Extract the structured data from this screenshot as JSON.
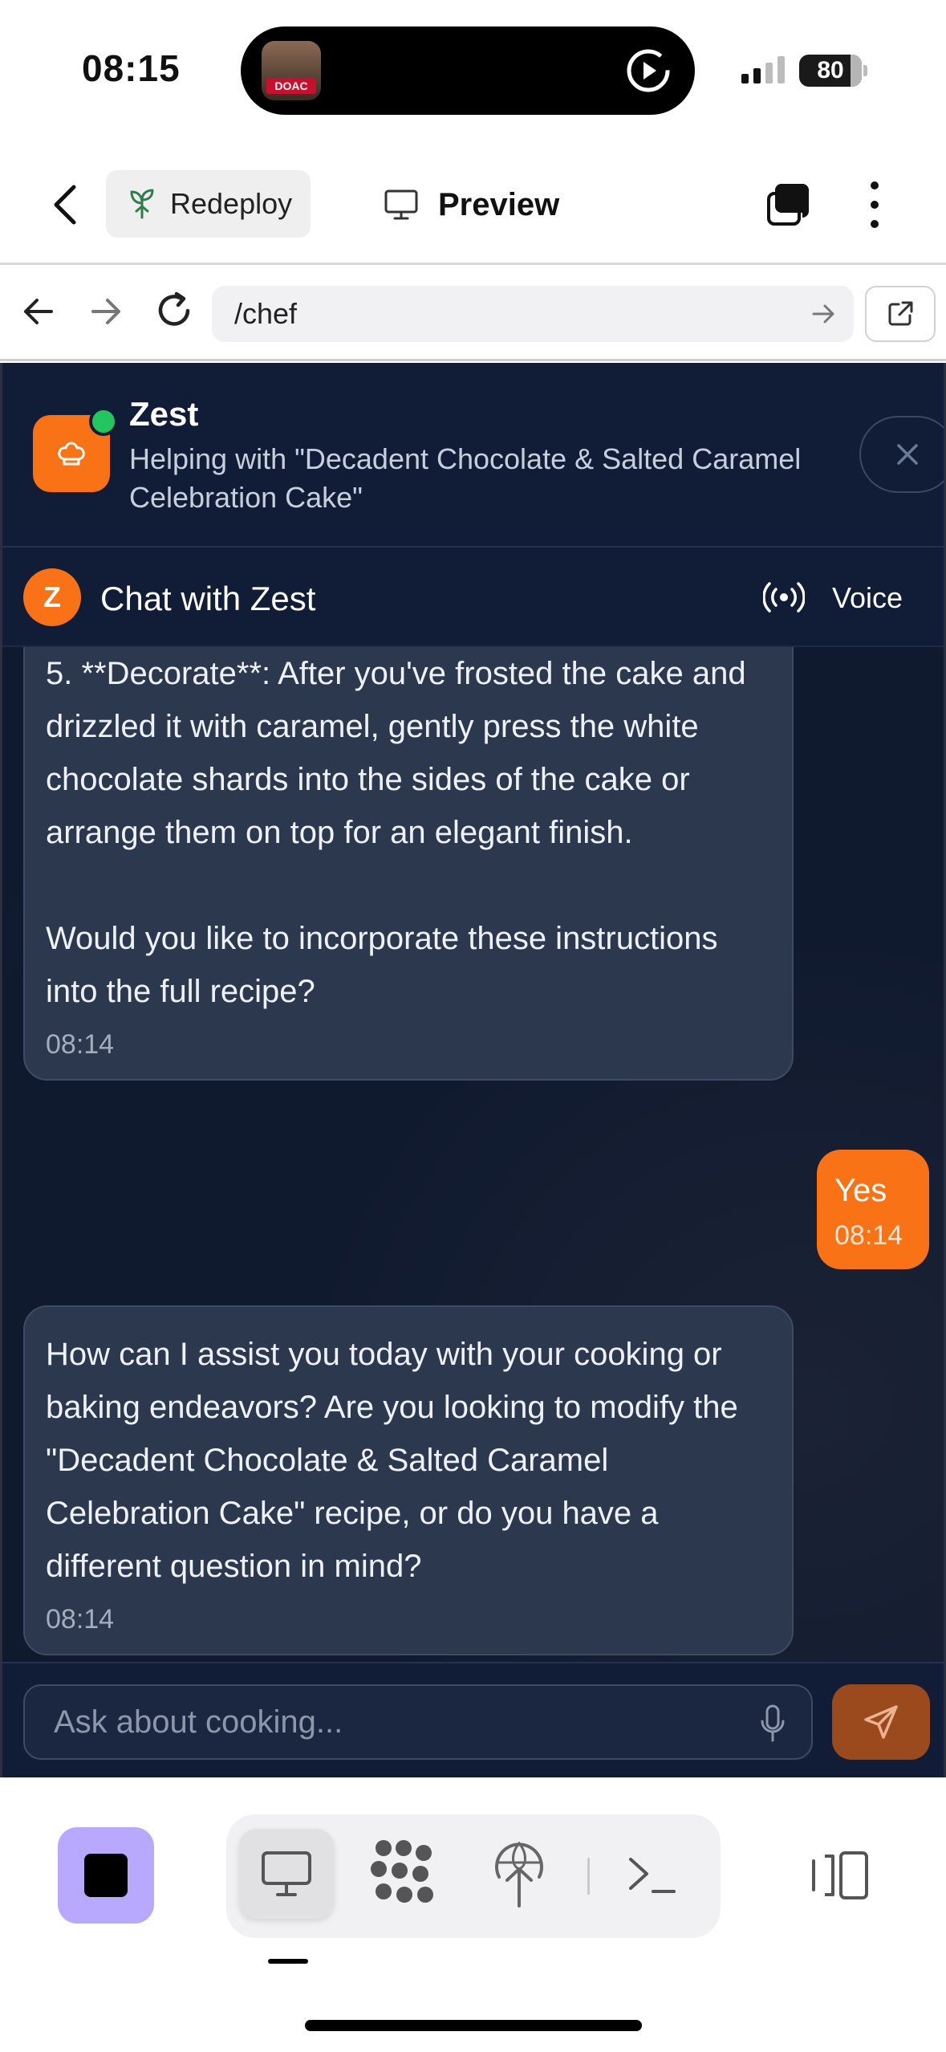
{
  "status_bar": {
    "time": "08:15",
    "battery": "80",
    "media_badge": "DOAC"
  },
  "toolbar": {
    "redeploy_label": "Redeploy",
    "preview_label": "Preview"
  },
  "browser": {
    "url": "/chef"
  },
  "assistant": {
    "name": "Zest",
    "subtitle": "Helping with \"Decadent Chocolate & Salted Caramel Celebration Cake\""
  },
  "chat": {
    "title": "Chat with Zest",
    "avatar_letter": "Z",
    "voice_label": "Voice",
    "messages": [
      {
        "role": "assistant",
        "text": "5. **Decorate**: After you've frosted the cake and drizzled it with caramel, gently press the white chocolate shards into the sides of the cake or arrange them on top for an elegant finish.\n\nWould you like to incorporate these instructions into the full recipe?",
        "time": "08:14"
      },
      {
        "role": "user",
        "text": "Yes",
        "time": "08:14"
      },
      {
        "role": "assistant",
        "text": "How can I assist you today with your cooking or baking endeavors? Are you looking to modify the \"Decadent Chocolate & Salted Caramel Celebration Cake\" recipe, or do you have a different question in mind?",
        "time": "08:14"
      }
    ],
    "input_placeholder": "Ask about cooking..."
  },
  "colors": {
    "accent": "#f97316",
    "chat_bg": "#0f1a30",
    "bubble_ai": "#2b384e",
    "online": "#22c55e",
    "stop_button": "#b8a9ff"
  },
  "icons": {
    "toolbar": [
      "chevron-left-icon",
      "sprout-icon",
      "monitor-icon",
      "tabs-icon",
      "more-vertical-icon"
    ],
    "browser": [
      "arrow-left-icon",
      "arrow-right-icon",
      "reload-icon",
      "external-link-icon"
    ],
    "chat": [
      "chef-hat-icon",
      "close-icon",
      "broadcast-icon",
      "mic-icon",
      "send-icon"
    ],
    "bottom": [
      "stop-icon",
      "desktop-icon",
      "apps-icon",
      "deploy-icon",
      "terminal-icon",
      "split-view-icon"
    ]
  }
}
